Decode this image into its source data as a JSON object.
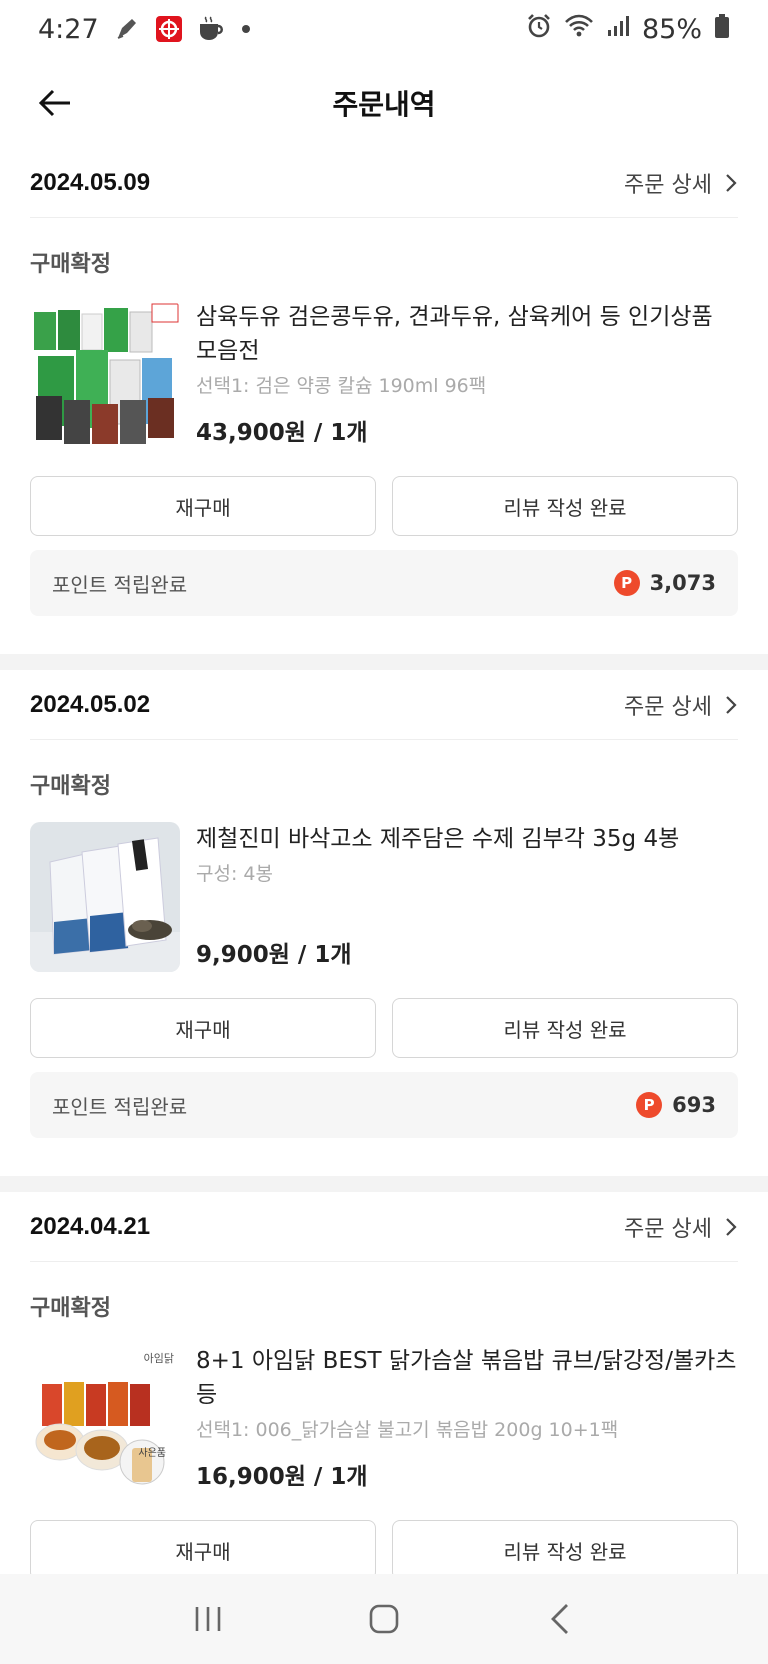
{
  "status_bar": {
    "time": "4:27",
    "battery": "85%",
    "icons": [
      "pen-icon",
      "app-icon",
      "cup-icon",
      "dot-icon",
      "alarm-icon",
      "wifi-icon",
      "signal-icon",
      "battery-icon"
    ]
  },
  "header": {
    "title": "주문내역",
    "back_icon": "arrow-left-icon"
  },
  "orders": [
    {
      "date": "2024.05.09",
      "detail_label": "주문 상세",
      "status": "구매확정",
      "product_name": "삼육두유 검은콩두유, 견과두유, 삼육케어 등 인기상품 모음전",
      "option": "선택1: 검은 약콩 칼슘 190ml 96팩",
      "price": "43,900원 / 1개",
      "rebuy_label": "재구매",
      "review_label": "리뷰 작성 완료",
      "points_label": "포인트 적립완료",
      "points_badge": "P",
      "points_value": "3,073"
    },
    {
      "date": "2024.05.02",
      "detail_label": "주문 상세",
      "status": "구매확정",
      "product_name": "제철진미 바삭고소 제주담은 수제 김부각 35g 4봉",
      "option": "구성: 4봉",
      "price": "9,900원 / 1개",
      "rebuy_label": "재구매",
      "review_label": "리뷰 작성 완료",
      "points_label": "포인트 적립완료",
      "points_badge": "P",
      "points_value": "693"
    },
    {
      "date": "2024.04.21",
      "detail_label": "주문 상세",
      "status": "구매확정",
      "product_name": "8+1 아임닭 BEST 닭가슴살 볶음밥 큐브/닭강정/볼카츠 등",
      "option": "선택1: 006_닭가슴살 불고기 볶음밥 200g 10+1팩",
      "price": "16,900원 / 1개",
      "rebuy_label": "재구매",
      "review_label": "리뷰 작성 완료",
      "brand_text": "아임닭",
      "gift_text": "사은품"
    }
  ],
  "colors": {
    "accent": "#ee4a2c",
    "points_bg": "#f6f6f6",
    "divider": "#f3f3f3"
  },
  "nav_bar": {
    "icons": [
      "recent-apps-icon",
      "home-icon",
      "back-icon"
    ]
  }
}
